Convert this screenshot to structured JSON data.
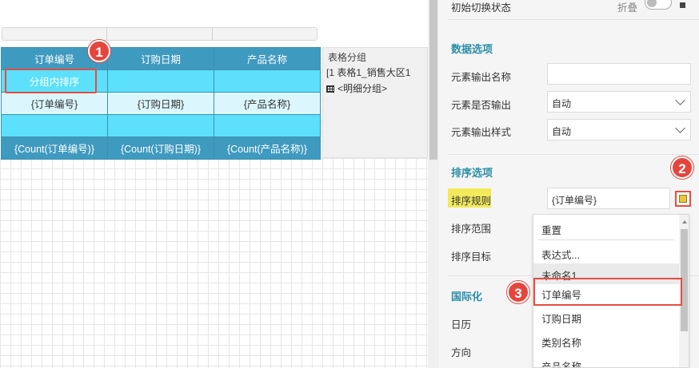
{
  "report": {
    "headers": [
      "订单编号",
      "订购日期",
      "产品名称"
    ],
    "group_row": [
      "分组内排序",
      "",
      ""
    ],
    "detail_row": [
      "{订单编号}",
      "{订购日期}",
      "{产品名称}"
    ],
    "empty_row": [
      "",
      "",
      ""
    ],
    "footer_row": [
      "{Count(订单编号)}",
      "{Count(订购日期)}",
      "{Count(产品名称)}"
    ]
  },
  "group_panel": {
    "title": "表格分组",
    "item1": "[1  表格1_销售大区1",
    "item2": "<明细分组>"
  },
  "props": {
    "init_state_label": "初始切换状态",
    "collapse_label": "折叠",
    "data_options_title": "数据选项",
    "element_name_label": "元素输出名称",
    "element_name_value": "",
    "element_output_label": "元素是否输出",
    "element_output_value": "自动",
    "element_style_label": "元素输出样式",
    "element_style_value": "自动",
    "sort_options_title": "排序选项",
    "sort_rule_label": "排序规则",
    "sort_rule_value": "{订单编号}",
    "sort_range_label": "排序范围",
    "sort_target_label": "排序目标",
    "i18n_title": "国际化",
    "calendar_label": "日历",
    "direction_label": "方向"
  },
  "dropdown": {
    "items": [
      "重置",
      "表达式...",
      "未命名1",
      "订单编号",
      "订购日期",
      "类别名称",
      "产品名称"
    ],
    "highlighted_index": 2,
    "selected_index": 3
  },
  "badges": [
    "1",
    "2",
    "3"
  ],
  "colors": {
    "header_bg": "#3f9abf",
    "group_bg": "#5ce0fb",
    "detail_bg": "#dbf7fd",
    "accent_red": "#e54d42",
    "section_teal": "#2b8ea8",
    "label_highlight": "#f3ea5b"
  }
}
